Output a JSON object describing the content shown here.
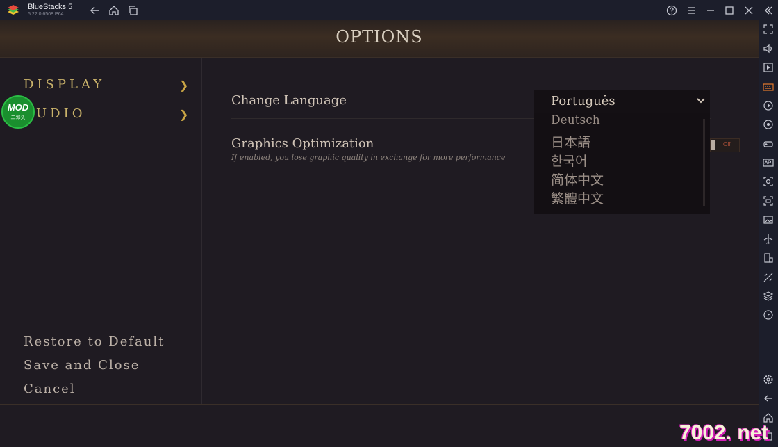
{
  "titlebar": {
    "app_name": "BlueStacks 5",
    "version": "5.22.0.6508  P64"
  },
  "game": {
    "header_title": "OPTIONS",
    "nav": [
      {
        "label": "DISPLAY",
        "chevron": "❯"
      },
      {
        "label": "AUDIO",
        "chevron": "❯"
      }
    ],
    "actions": {
      "restore": "Restore to Default",
      "save_close": "Save and Close",
      "cancel": "Cancel"
    },
    "options": {
      "language": {
        "label": "Change Language",
        "selected": "Português",
        "options": [
          "Deutsch",
          "日本語",
          "한국어",
          "简体中文",
          "繁體中文"
        ]
      },
      "graphics": {
        "label": "Graphics Optimization",
        "description": "If enabled, you lose graphic quality in exchange for more performance",
        "toggle_state": "Off"
      }
    }
  },
  "overlays": {
    "mod_badge": "MOD",
    "mod_sub": "二郭头",
    "watermark": "7002. net"
  },
  "colors": {
    "gold": "#c9b26a",
    "text": "#cfc3b6",
    "bluestacks_bar": "#1c1e2b"
  },
  "icons": {
    "titlebar": [
      "back-arrow-icon",
      "home-icon",
      "multi-instance-icon",
      "help-icon",
      "menu-icon",
      "minimize-icon",
      "maximize-icon",
      "close-icon",
      "collapse-sidebar-icon"
    ],
    "sidebar": [
      "fullscreen-icon",
      "volume-icon",
      "media-icon",
      "keyboard-icon",
      "macro-icon",
      "sync-icon",
      "gamepad-icon",
      "apk-icon",
      "screenshot-icon",
      "record-icon",
      "gallery-icon",
      "airplane-icon",
      "rotate-icon",
      "eco-icon",
      "layers-icon",
      "speed-icon",
      "settings-icon",
      "back-icon",
      "home-nav-icon",
      "recent-apps-icon"
    ]
  }
}
